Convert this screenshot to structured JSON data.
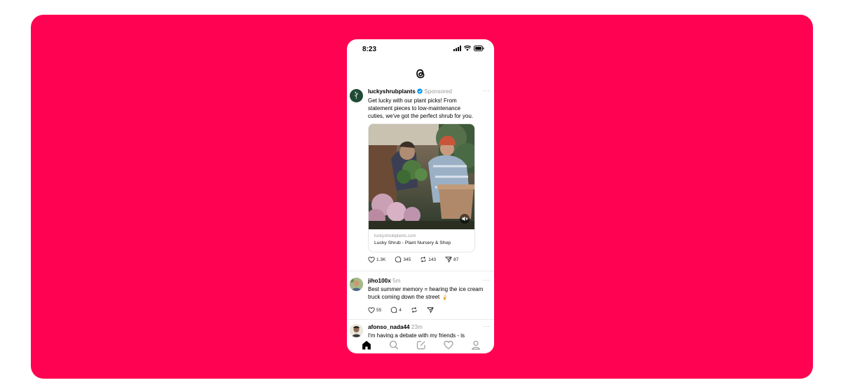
{
  "status": {
    "time": "8:23"
  },
  "app": {
    "name": "Threads",
    "logo_icon": "threads-logo-icon"
  },
  "posts": [
    {
      "username": "luckyshrubplants",
      "verified": true,
      "meta": "Sponsored",
      "more": "···",
      "text_lines": [
        "Get lucky with our plant picks! From",
        "statement pieces to low-maintenance",
        "cuties, we've got the perfect shrub for you."
      ],
      "link_domain": "luckyshrubplants.com",
      "link_title": "Lucky Shrub - Plant Nursery & Shop",
      "likes": "1.3K",
      "replies": "345",
      "reposts": "143",
      "shares": "87"
    },
    {
      "username": "jiho100x",
      "meta": "5m",
      "more": "···",
      "text_lines": [
        "Best summer memory = hearing the ice cream",
        "truck coming down the street 🍦"
      ],
      "likes": "55",
      "replies": "4"
    },
    {
      "username": "afonso_nada44",
      "meta": "23m",
      "more": "···",
      "text_lines": [
        "I'm having a debate with my friends - is"
      ]
    }
  ],
  "nav": [
    "home-icon",
    "search-icon",
    "compose-icon",
    "heart-icon",
    "profile-icon"
  ],
  "colors": {
    "background": "#ff0251",
    "phone": "#ffffff",
    "accent": "#0095f6"
  }
}
